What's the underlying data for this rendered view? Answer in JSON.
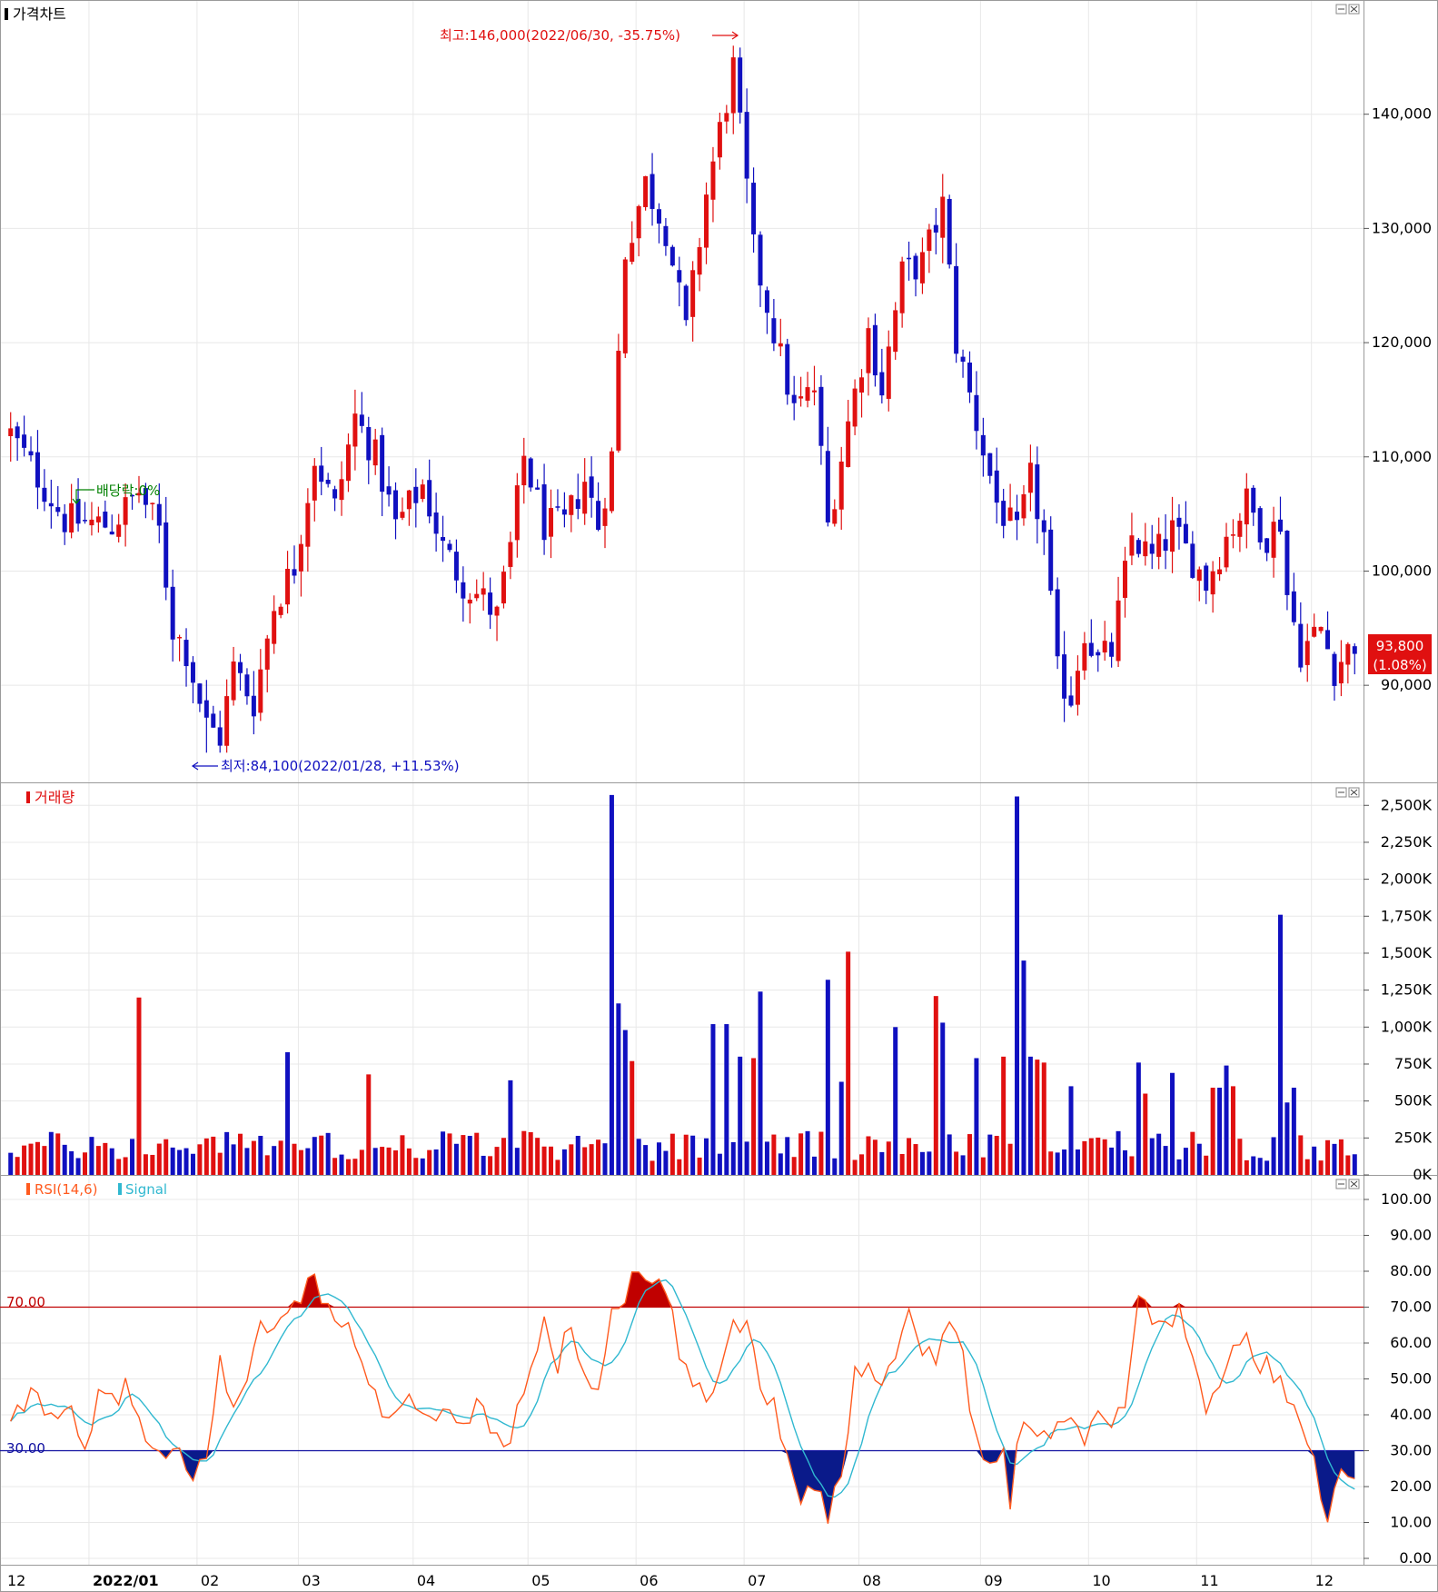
{
  "colors": {
    "up": "#e01010",
    "down": "#1010c0",
    "rsi": "#ff5a1e",
    "signal": "#30b8d0",
    "grid": "#e8e8e8",
    "axis": "#000000"
  },
  "price_panel": {
    "title": "가격차트",
    "high_label": "최고:146,000(2022/06/30, -35.75%)",
    "low_label": "최저:84,100(2022/01/28, +11.53%)",
    "dividend_label": "배당락:0%",
    "current_price": "93,800",
    "current_change": "(1.08%)"
  },
  "volume_panel": {
    "title": "거래량"
  },
  "rsi_panel": {
    "title_rsi": "RSI(14,6)",
    "title_signal": "Signal",
    "upper_line_label": "70.00",
    "lower_line_label": "30.00"
  },
  "x_axis": {
    "labels": [
      "12",
      "2022/01",
      "02",
      "03",
      "04",
      "05",
      "06",
      "07",
      "08",
      "09",
      "10",
      "11",
      "12"
    ]
  },
  "chart_data": [
    {
      "type": "candlestick",
      "title": "가격차트",
      "y_ticks": [
        "140,000",
        "130,000",
        "120,000",
        "110,000",
        "100,000",
        "90,000"
      ],
      "ylim": [
        81500,
        150000
      ],
      "high": 146000,
      "high_date": "2022/06/30",
      "low": 84100,
      "low_date": "2022/01/28",
      "last": 93800,
      "last_change_pct": 1.08,
      "close_path": [
        [
          0,
          112000
        ],
        [
          8,
          104500
        ],
        [
          15,
          104000
        ],
        [
          19,
          107000
        ],
        [
          22,
          103500
        ],
        [
          24,
          95000
        ],
        [
          26,
          93000
        ],
        [
          29,
          86500
        ],
        [
          31,
          85500
        ],
        [
          33,
          91500
        ],
        [
          36,
          88500
        ],
        [
          39,
          97000
        ],
        [
          42,
          100500
        ],
        [
          45,
          110000
        ],
        [
          48,
          105500
        ],
        [
          51,
          113500
        ],
        [
          54,
          110000
        ],
        [
          57,
          104000
        ],
        [
          61,
          107500
        ],
        [
          64,
          102000
        ],
        [
          67,
          99000
        ],
        [
          70,
          97500
        ],
        [
          72,
          96000
        ],
        [
          74,
          102000
        ],
        [
          76,
          110000
        ],
        [
          79,
          104000
        ],
        [
          82,
          104000
        ],
        [
          85,
          108000
        ],
        [
          87,
          104000
        ],
        [
          89,
          110000
        ],
        [
          91,
          128000
        ],
        [
          94,
          134000
        ],
        [
          97,
          130000
        ],
        [
          100,
          121000
        ],
        [
          103,
          133000
        ],
        [
          107,
          144000
        ],
        [
          110,
          128000
        ],
        [
          113,
          121000
        ],
        [
          116,
          114000
        ],
        [
          119,
          116000
        ],
        [
          121,
          104000
        ],
        [
          124,
          113000
        ],
        [
          127,
          121000
        ],
        [
          129,
          116000
        ],
        [
          132,
          126000
        ],
        [
          135,
          127000
        ],
        [
          138,
          132000
        ],
        [
          140,
          120000
        ],
        [
          143,
          113000
        ],
        [
          146,
          106000
        ],
        [
          149,
          103000
        ],
        [
          151,
          108000
        ],
        [
          153,
          103000
        ],
        [
          155,
          91000
        ],
        [
          157,
          89000
        ],
        [
          159,
          95000
        ],
        [
          161,
          92000
        ],
        [
          163,
          93000
        ],
        [
          166,
          103000
        ],
        [
          169,
          101000
        ],
        [
          172,
          103500
        ],
        [
          175,
          101000
        ],
        [
          177,
          99000
        ],
        [
          180,
          103000
        ],
        [
          183,
          106000
        ],
        [
          186,
          103000
        ],
        [
          188,
          104500
        ],
        [
          189,
          98000
        ],
        [
          191,
          93000
        ],
        [
          194,
          95000
        ],
        [
          196,
          91500
        ],
        [
          199,
          93800
        ]
      ],
      "volatility": 1600
    },
    {
      "type": "bar",
      "title": "거래량",
      "y_ticks": [
        "2,500K",
        "2,250K",
        "2,000K",
        "1,750K",
        "1,500K",
        "1,250K",
        "1,000K",
        "750K",
        "500K",
        "250K",
        "0K"
      ],
      "ylim": [
        0,
        2600
      ],
      "unit": "K",
      "base_volume": 270,
      "spikes": [
        [
          19,
          1200
        ],
        [
          41,
          830
        ],
        [
          53,
          680
        ],
        [
          74,
          640
        ],
        [
          89,
          2570
        ],
        [
          90,
          1160
        ],
        [
          91,
          980
        ],
        [
          92,
          770
        ],
        [
          104,
          1020
        ],
        [
          106,
          1020
        ],
        [
          108,
          800
        ],
        [
          110,
          790
        ],
        [
          111,
          1240
        ],
        [
          121,
          1320
        ],
        [
          123,
          630
        ],
        [
          124,
          1510
        ],
        [
          131,
          1000
        ],
        [
          137,
          1210
        ],
        [
          138,
          1030
        ],
        [
          143,
          790
        ],
        [
          147,
          800
        ],
        [
          149,
          2560
        ],
        [
          150,
          1450
        ],
        [
          151,
          800
        ],
        [
          152,
          780
        ],
        [
          153,
          760
        ],
        [
          157,
          600
        ],
        [
          167,
          760
        ],
        [
          168,
          550
        ],
        [
          172,
          690
        ],
        [
          178,
          590
        ],
        [
          179,
          590
        ],
        [
          180,
          740
        ],
        [
          181,
          600
        ],
        [
          188,
          1760
        ],
        [
          189,
          490
        ],
        [
          190,
          590
        ]
      ]
    },
    {
      "type": "line",
      "series": [
        "RSI(14,6)",
        "Signal"
      ],
      "y_ticks": [
        "100.00",
        "90.00",
        "80.00",
        "70.00",
        "60.00",
        "50.00",
        "40.00",
        "30.00",
        "20.00",
        "10.00",
        "0.00"
      ],
      "ylim": [
        0,
        105
      ],
      "reference_lines": [
        70,
        30
      ],
      "rsi_path": [
        [
          0,
          36
        ],
        [
          3,
          46
        ],
        [
          6,
          42
        ],
        [
          9,
          39
        ],
        [
          11,
          28
        ],
        [
          13,
          44
        ],
        [
          17,
          47
        ],
        [
          19,
          38
        ],
        [
          21,
          30
        ],
        [
          23,
          26
        ],
        [
          25,
          29
        ],
        [
          27,
          21
        ],
        [
          29,
          30
        ],
        [
          31,
          55
        ],
        [
          33,
          40
        ],
        [
          35,
          50
        ],
        [
          37,
          69
        ],
        [
          39,
          63
        ],
        [
          41,
          67
        ],
        [
          43,
          74
        ],
        [
          45,
          77
        ],
        [
          47,
          71
        ],
        [
          49,
          64
        ],
        [
          51,
          61
        ],
        [
          53,
          48
        ],
        [
          55,
          42
        ],
        [
          57,
          38
        ],
        [
          59,
          44
        ],
        [
          61,
          40
        ],
        [
          63,
          35
        ],
        [
          65,
          42
        ],
        [
          67,
          38
        ],
        [
          69,
          43
        ],
        [
          71,
          38
        ],
        [
          73,
          30
        ],
        [
          75,
          40
        ],
        [
          77,
          55
        ],
        [
          79,
          64
        ],
        [
          81,
          54
        ],
        [
          83,
          66
        ],
        [
          85,
          50
        ],
        [
          87,
          47
        ],
        [
          89,
          70
        ],
        [
          91,
          74
        ],
        [
          93,
          79
        ],
        [
          95,
          76
        ],
        [
          97,
          74
        ],
        [
          99,
          58
        ],
        [
          101,
          47
        ],
        [
          103,
          44
        ],
        [
          105,
          52
        ],
        [
          107,
          68
        ],
        [
          109,
          64
        ],
        [
          111,
          50
        ],
        [
          113,
          42
        ],
        [
          115,
          30
        ],
        [
          117,
          18
        ],
        [
          119,
          22
        ],
        [
          121,
          12
        ],
        [
          123,
          24
        ],
        [
          125,
          50
        ],
        [
          127,
          56
        ],
        [
          129,
          50
        ],
        [
          131,
          57
        ],
        [
          133,
          68
        ],
        [
          135,
          60
        ],
        [
          137,
          52
        ],
        [
          139,
          67
        ],
        [
          141,
          57
        ],
        [
          143,
          32
        ],
        [
          145,
          30
        ],
        [
          147,
          30
        ],
        [
          148,
          12
        ],
        [
          149,
          33
        ],
        [
          151,
          38
        ],
        [
          153,
          34
        ],
        [
          155,
          38
        ],
        [
          157,
          38
        ],
        [
          159,
          35
        ],
        [
          161,
          42
        ],
        [
          163,
          36
        ],
        [
          165,
          45
        ],
        [
          167,
          75
        ],
        [
          169,
          64
        ],
        [
          171,
          66
        ],
        [
          173,
          70
        ],
        [
          175,
          55
        ],
        [
          177,
          40
        ],
        [
          179,
          50
        ],
        [
          181,
          57
        ],
        [
          183,
          60
        ],
        [
          185,
          55
        ],
        [
          187,
          52
        ],
        [
          189,
          47
        ],
        [
          191,
          35
        ],
        [
          193,
          25
        ],
        [
          195,
          12
        ],
        [
          197,
          28
        ],
        [
          199,
          24
        ]
      ],
      "signal_smoothing": 6
    }
  ]
}
